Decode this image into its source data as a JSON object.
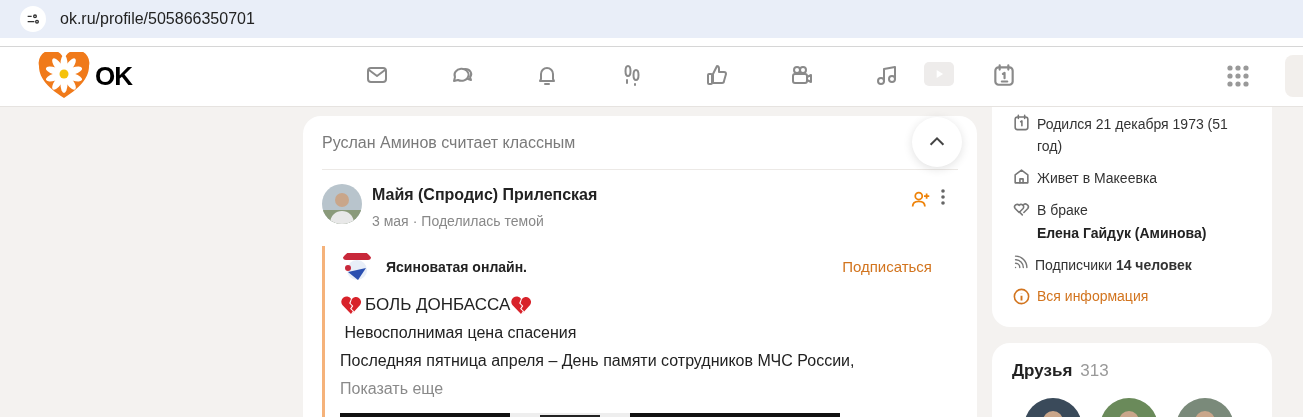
{
  "address_bar": {
    "url": "ok.ru/profile/505866350701"
  },
  "header": {
    "logo": "OK"
  },
  "feed": {
    "activity": "Руслан Аминов считает классным",
    "post": {
      "author": "Майя (Спродис) Прилепская",
      "date": "3 мая",
      "separator": "·",
      "action": "Поделилась темой",
      "group": {
        "name": "Ясиноватая онлайн.",
        "subscribe": "Подписаться"
      },
      "lines": [
        {
          "kind": "heart-title",
          "text": "БОЛЬ ДОНБАССА"
        },
        {
          "kind": "plain",
          "text": " Невосполнимая цена спасения"
        },
        {
          "kind": "plain",
          "text": "Последняя пятница апреля – День памяти сотрудников МЧС России,"
        }
      ],
      "show_more": "Показать еще"
    }
  },
  "about": {
    "items": [
      {
        "kind": "birthday",
        "text": "Родился 21 декабря 1973 (51 год)"
      },
      {
        "kind": "home",
        "text": "Живет в Макеевка"
      },
      {
        "kind": "marriage",
        "text": "В браке",
        "detail": "Елена Гайдук (Аминова)"
      },
      {
        "kind": "followers",
        "text": "Подписчики **14 человек**"
      }
    ],
    "all_info": "Вся информация"
  },
  "friends": {
    "title": "Друзья",
    "count": "313"
  }
}
